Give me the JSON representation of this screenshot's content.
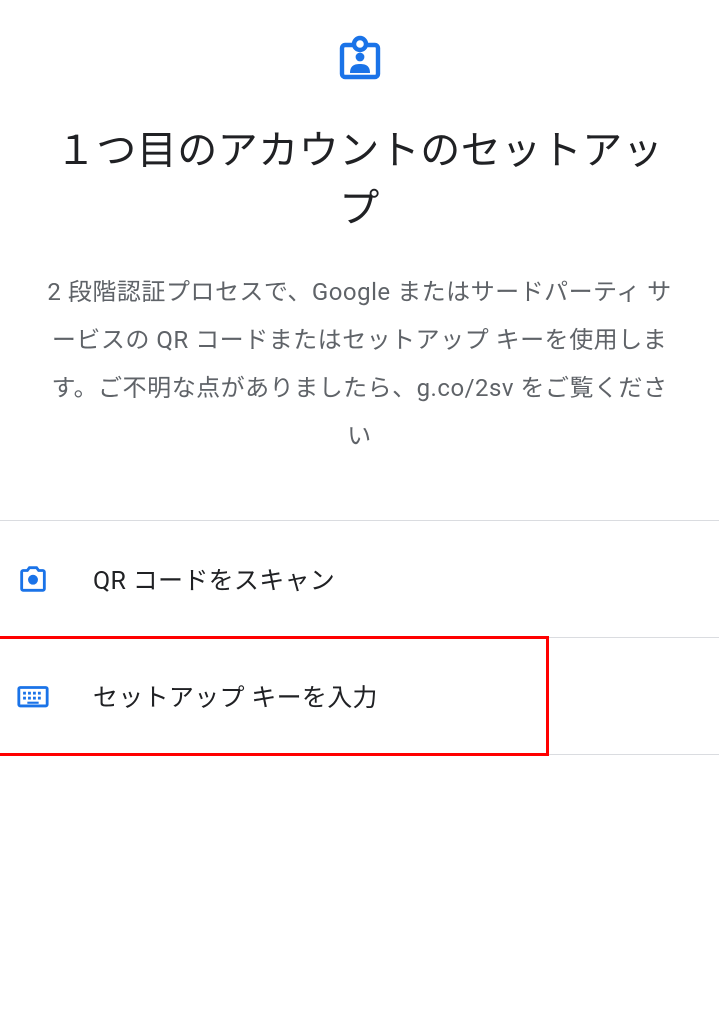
{
  "header": {
    "icon": "account-box-icon"
  },
  "title": "１つ目のアカウントのセットアップ",
  "description": "2 段階認証プロセスで、Google またはサードパーティ サービスの QR コードまたはセットアップ キーを使用します。ご不明な点がありましたら、g.co/2sv をご覧ください",
  "options": [
    {
      "icon": "camera-icon",
      "label": "QR コードをスキャン",
      "highlighted": false
    },
    {
      "icon": "keyboard-icon",
      "label": "セットアップ キーを入力",
      "highlighted": true
    }
  ],
  "colors": {
    "accent": "#1a73e8",
    "highlight": "#ff0000"
  }
}
